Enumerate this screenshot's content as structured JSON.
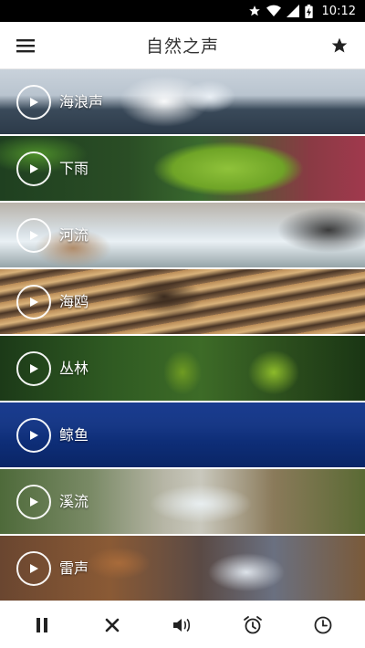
{
  "status_bar": {
    "time": "10:12",
    "icons": [
      "star-icon",
      "wifi-icon",
      "signal-icon",
      "battery-charging-icon"
    ]
  },
  "app_bar": {
    "title": "自然之声",
    "left_icon": "menu-icon",
    "right_icon": "star-icon"
  },
  "sounds": [
    {
      "label": "海浪声",
      "icon": "play-icon"
    },
    {
      "label": "下雨",
      "icon": "play-icon"
    },
    {
      "label": "河流",
      "icon": "play-icon"
    },
    {
      "label": "海鸥",
      "icon": "play-icon"
    },
    {
      "label": "丛林",
      "icon": "play-icon"
    },
    {
      "label": "鲸鱼",
      "icon": "play-icon"
    },
    {
      "label": "溪流",
      "icon": "play-icon"
    },
    {
      "label": "雷声",
      "icon": "play-icon"
    }
  ],
  "toolbar": {
    "items": [
      "pause-icon",
      "close-icon",
      "volume-icon",
      "alarm-clock-icon",
      "timer-clock-icon"
    ]
  },
  "colors": {
    "status_bar": "#000000",
    "app_bar_bg": "#ffffff",
    "title_text": "#333333",
    "icon_dark": "#222222"
  }
}
